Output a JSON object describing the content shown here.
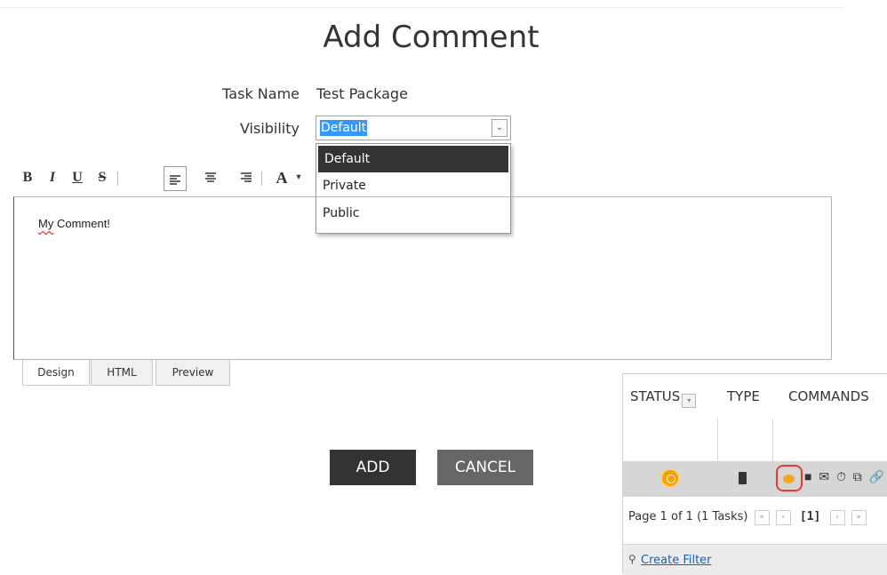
{
  "page": {
    "title": "Add Comment"
  },
  "form": {
    "task_name_label": "Task Name",
    "task_name_value": "Test Package",
    "visibility_label": "Visibility",
    "visibility_selected": "Default",
    "visibility_options": [
      "Default",
      "Private",
      "Public"
    ]
  },
  "toolbar": {
    "bold": "B",
    "italic": "I",
    "underline": "U",
    "strike": "S",
    "font_color": "A",
    "font_color_caret": "▾"
  },
  "editor": {
    "content_first": "My",
    "content_rest": " Comment!"
  },
  "editor_tabs": [
    "Design",
    "HTML",
    "Preview"
  ],
  "buttons": {
    "add": "ADD",
    "cancel": "CANCEL"
  },
  "task_panel": {
    "columns": [
      "STATUS",
      "TYPE",
      "COMMANDS"
    ],
    "command_icons": "■ ✉ ⏱ ⧉ 🔗",
    "pager_text": "Page 1 of 1 (1 Tasks)",
    "current_page": "[1]",
    "filter_link": "Create Filter"
  }
}
